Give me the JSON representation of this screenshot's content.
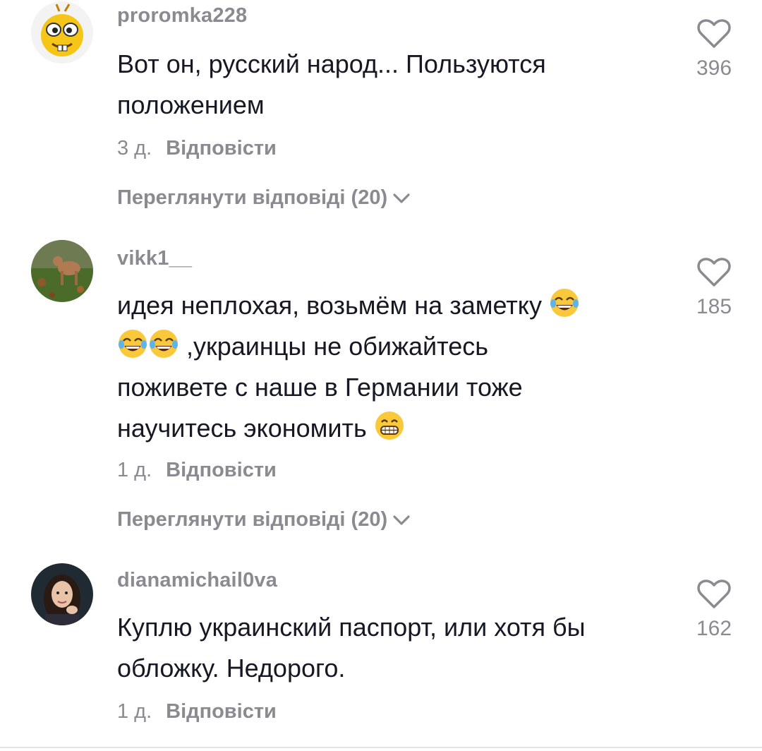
{
  "comments": [
    {
      "username": "proromka228",
      "text": [
        "Вот он, русский народ... Пользуются",
        "положением"
      ],
      "time": "3 д.",
      "reply_label": "Відповісти",
      "view_replies": "Переглянути відповіді (20)",
      "likes": "396"
    },
    {
      "username": "vikk1__",
      "text": [
        "идея неплохая, возьмём на заметку",
        ",украинцы не обижайтесь",
        "поживете с наше в Германии тоже",
        "научитесь экономить"
      ],
      "time": "1 д.",
      "reply_label": "Відповісти",
      "view_replies": "Переглянути відповіді (20)",
      "likes": "185"
    },
    {
      "username": "dianamichail0va",
      "text": [
        "Куплю украинский паспорт, или хотя бы",
        "обложку. Недорого."
      ],
      "time": "1 д.",
      "reply_label": "Відповісти",
      "likes": "162"
    }
  ],
  "colors": {
    "meta_gray": "#8a8b91",
    "text_dark": "#161823",
    "emoji_yellow": "#f9c93b"
  },
  "icons": {
    "like": "heart-outline-icon",
    "expand": "chevron-down-icon",
    "emoji_laugh": "face-with-tears-of-joy-icon",
    "emoji_grin": "grinning-face-icon"
  }
}
